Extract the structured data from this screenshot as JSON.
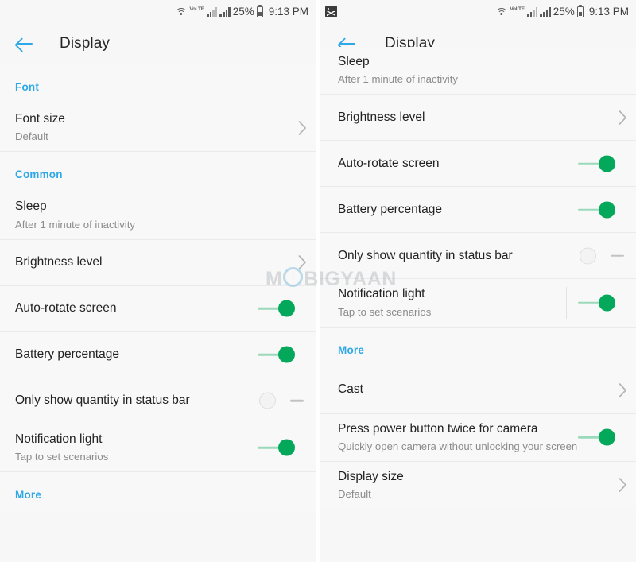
{
  "status_bar": {
    "notification_icon": "screenshot-image-icon",
    "wifi_icon": "wifi-icon",
    "volte_label": "VoLTE",
    "signal_icon_1": "signal-bars-icon",
    "signal_icon_2": "signal-bars-icon",
    "battery_percent": "25%",
    "battery_icon": "battery-icon",
    "time": "9:13 PM"
  },
  "app_bar": {
    "back_icon": "back-arrow-icon",
    "title": "Display"
  },
  "left_panel": {
    "sections": [
      {
        "header": "Font",
        "rows": [
          {
            "primary": "Font size",
            "secondary": "Default",
            "control": "chevron"
          }
        ]
      },
      {
        "header": "Common",
        "rows": [
          {
            "primary": "Sleep",
            "secondary": "After 1 minute of inactivity",
            "control": "none"
          },
          {
            "primary": "Brightness level",
            "secondary": "",
            "control": "chevron"
          },
          {
            "primary": "Auto-rotate screen",
            "secondary": "",
            "control": "toggle-on"
          },
          {
            "primary": "Battery percentage",
            "secondary": "",
            "control": "toggle-on"
          },
          {
            "primary": "Only show quantity in status bar",
            "secondary": "",
            "control": "toggle-off"
          },
          {
            "primary": "Notification light",
            "secondary": "Tap to set scenarios",
            "control": "toggle-on-divider"
          }
        ]
      },
      {
        "header": "More",
        "rows": []
      }
    ]
  },
  "right_panel": {
    "sections": [
      {
        "header": "",
        "rows": [
          {
            "primary": "Sleep",
            "secondary": "After 1 minute of inactivity",
            "control": "none"
          },
          {
            "primary": "Brightness level",
            "secondary": "",
            "control": "chevron"
          },
          {
            "primary": "Auto-rotate screen",
            "secondary": "",
            "control": "toggle-on"
          },
          {
            "primary": "Battery percentage",
            "secondary": "",
            "control": "toggle-on"
          },
          {
            "primary": "Only show quantity in status bar",
            "secondary": "",
            "control": "toggle-off"
          },
          {
            "primary": "Notification light",
            "secondary": "Tap to set scenarios",
            "control": "toggle-on-divider"
          }
        ]
      },
      {
        "header": "More",
        "rows": [
          {
            "primary": "Cast",
            "secondary": "",
            "control": "chevron"
          },
          {
            "primary": "Press power button twice for camera",
            "secondary": "Quickly open camera without unlocking your screen",
            "control": "toggle-on"
          },
          {
            "primary": "Display size",
            "secondary": "Default",
            "control": "chevron"
          }
        ]
      }
    ]
  },
  "watermark": {
    "prefix": "M",
    "suffix": "BIGYAAN"
  },
  "colors": {
    "accent_blue": "#2fa8e8",
    "toggle_on_green": "#04a85a",
    "toggle_on_track": "#9ad9bb",
    "toggle_off_track": "#c2c2c2",
    "panel_bg": "#f8f8f8",
    "primary_text": "#222222",
    "secondary_text": "#8b8b8b"
  }
}
